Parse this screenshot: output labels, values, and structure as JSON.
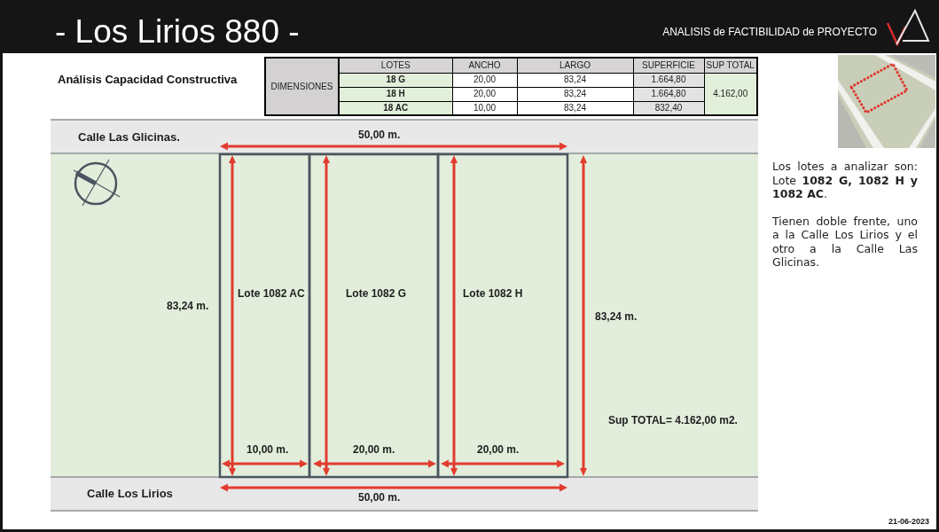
{
  "header": {
    "title": "- Los Lirios 880 -",
    "subtitle": "ANALISIS de FACTIBILIDAD de PROYECTO"
  },
  "section_title": "Análisis Capacidad Constructiva",
  "table": {
    "row_header": "DIMENSIONES",
    "columns": [
      "LOTES",
      "ANCHO",
      "LARGO",
      "SUPERFICIE",
      "SUP TOTAL"
    ],
    "rows": [
      [
        "18 G",
        "20,00",
        "83,24",
        "1.664,80"
      ],
      [
        "18 H",
        "20,00",
        "83,24",
        "1.664,80"
      ],
      [
        "18 AC",
        "10,00",
        "83,24",
        "832,40"
      ]
    ],
    "total": "4.162,00"
  },
  "plan": {
    "streets": [
      {
        "name": "Calle Las Glicinas.",
        "frontage": "50,00 m."
      },
      {
        "name": "Calle Los Lirios",
        "frontage": "50,00 m."
      }
    ],
    "depth_labels": [
      "83,24 m.",
      "83,24 m."
    ],
    "lots": [
      {
        "name": "Lote 1082 AC",
        "width": "10,00 m."
      },
      {
        "name": "Lote 1082 G",
        "width": "20,00 m."
      },
      {
        "name": "Lote 1082 H",
        "width": "20,00 m."
      }
    ],
    "total_area": "Sup TOTAL= 4.162,00 m2."
  },
  "notes": [
    "Los lotes a analizar son: Lote **1082 G, 1082 H y 1082 AC**.",
    "Tienen doble frente, uno a la Calle Los Lirios y el otro a la Calle Las Glicinas."
  ],
  "date": "21-06-2023"
}
